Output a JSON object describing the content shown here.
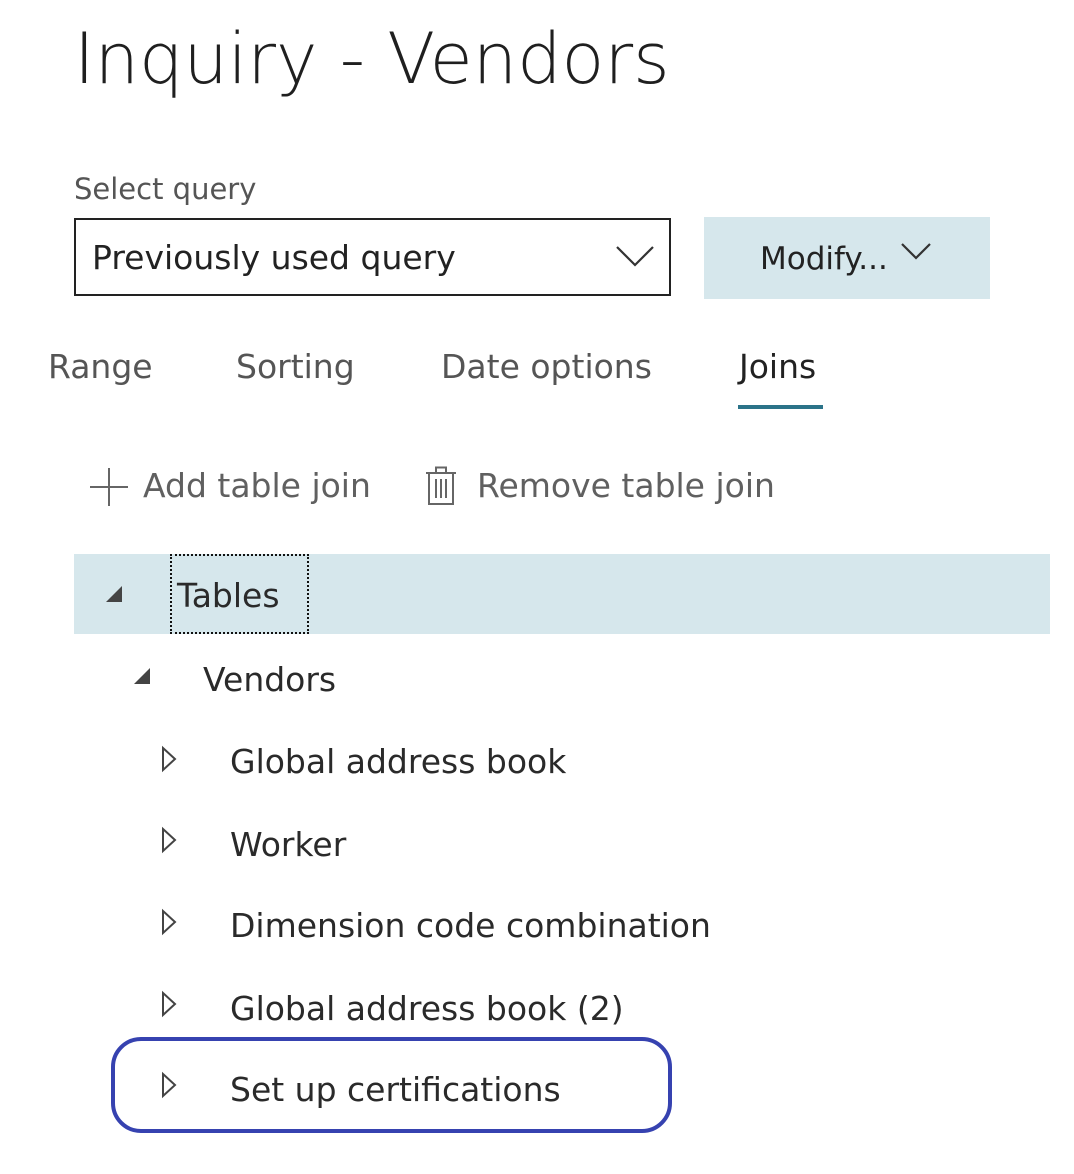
{
  "page": {
    "title": "Inquiry - Vendors"
  },
  "query": {
    "label": "Select query",
    "value": "Previously used query",
    "modify_label": "Modify..."
  },
  "tabs": [
    {
      "label": "Range",
      "active": false
    },
    {
      "label": "Sorting",
      "active": false
    },
    {
      "label": "Date options",
      "active": false
    },
    {
      "label": "Joins",
      "active": true
    }
  ],
  "toolbar": {
    "add_label": "Add table join",
    "remove_label": "Remove table join"
  },
  "tree": {
    "root": {
      "label": "Tables",
      "expanded": true,
      "selected": true
    },
    "vendors": {
      "label": "Vendors",
      "expanded": true
    },
    "children": [
      {
        "label": "Global address book",
        "expanded": false
      },
      {
        "label": "Worker",
        "expanded": false
      },
      {
        "label": "Dimension code combination",
        "expanded": false
      },
      {
        "label": "Global address book (2)",
        "expanded": false
      },
      {
        "label": "Set up certifications",
        "expanded": false,
        "highlighted": true
      }
    ]
  },
  "colors": {
    "accent": "#2b7389",
    "selection": "#d6e7ec",
    "highlight_ring": "#3642b0"
  }
}
